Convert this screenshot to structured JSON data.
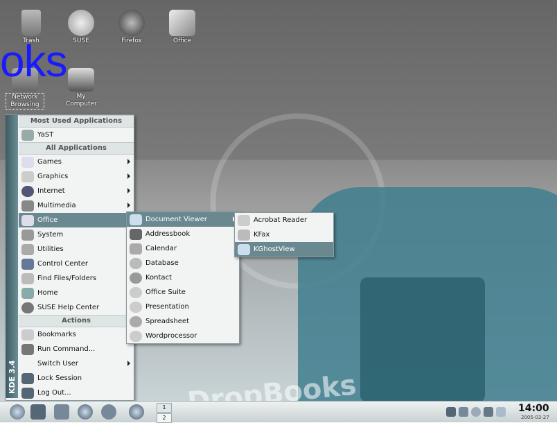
{
  "desktop": {
    "icons": [
      {
        "label": "Trash"
      },
      {
        "label": "SUSE"
      },
      {
        "label": "Firefox"
      },
      {
        "label": "Office"
      },
      {
        "label": "Network Browsing"
      },
      {
        "label": "My Computer"
      }
    ],
    "overlay_text": "oks",
    "wallpaper_text": "DropBooks"
  },
  "kmenu": {
    "side_label": "KDE 3.4",
    "most_used_header": "Most Used Applications",
    "all_apps_header": "All Applications",
    "actions_header": "Actions",
    "items": {
      "yast": "YaST",
      "games": "Games",
      "graphics": "Graphics",
      "internet": "Internet",
      "multimedia": "Multimedia",
      "office": "Office",
      "system": "System",
      "utilities": "Utilities",
      "control_center": "Control Center",
      "find_files": "Find Files/Folders",
      "home": "Home",
      "help": "SUSE Help Center",
      "bookmarks": "Bookmarks",
      "run_command": "Run Command...",
      "switch_user": "Switch User",
      "lock_session": "Lock Session",
      "log_out": "Log Out..."
    }
  },
  "office_menu": {
    "items": [
      "Document Viewer",
      "Addressbook",
      "Calendar",
      "Database",
      "Kontact",
      "Office Suite",
      "Presentation",
      "Spreadsheet",
      "Wordprocessor"
    ]
  },
  "docviewer_menu": {
    "items": [
      "Acrobat Reader",
      "KFax",
      "KGhostView"
    ]
  },
  "taskbar": {
    "pager": [
      "1",
      "2"
    ],
    "clock_time": "14:00",
    "clock_date": "2005-03-27"
  },
  "colors": {
    "highlight": "#6a8890",
    "teal": "#3f7e8e"
  }
}
